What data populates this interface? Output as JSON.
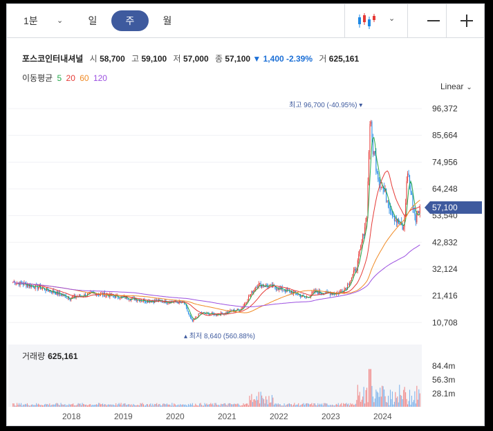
{
  "timeframes": {
    "minute": "1분",
    "day": "일",
    "week": "주",
    "month": "월",
    "active": "week"
  },
  "quote": {
    "name": "포스코인터내셔널",
    "open_label": "시",
    "open": "58,700",
    "high_label": "고",
    "high": "59,100",
    "low_label": "저",
    "low": "57,000",
    "close_label": "종",
    "close": "57,100",
    "change": "▼ 1,400 -2.39%",
    "vol_label": "거",
    "vol": "625,161"
  },
  "ma": {
    "label": "이동평균",
    "p5": "5",
    "p20": "20",
    "p60": "60",
    "p120": "120",
    "colors": {
      "p5": "#22a84a",
      "p20": "#e53935",
      "p60": "#f08a24",
      "p120": "#9b4fe0"
    }
  },
  "scale_mode": "Linear",
  "price_axis": {
    "ticks": [
      "96,372",
      "85,664",
      "74,956",
      "64,248",
      "53,540",
      "42,832",
      "32,124",
      "21,416",
      "10,708"
    ],
    "current": "57,100"
  },
  "annotations": {
    "max": "최고 96,700 (-40.95%)",
    "min": "최저 8,640 (560.88%)"
  },
  "volume": {
    "label": "거래량",
    "value": "625,161",
    "ticks": [
      "84.4m",
      "56.3m",
      "28.1m"
    ]
  },
  "x_axis": [
    "2018",
    "2019",
    "2020",
    "2021",
    "2022",
    "2023",
    "2024"
  ],
  "colors": {
    "up": "#e53935",
    "down": "#1e88e5",
    "accent": "#3e5a9e"
  }
}
